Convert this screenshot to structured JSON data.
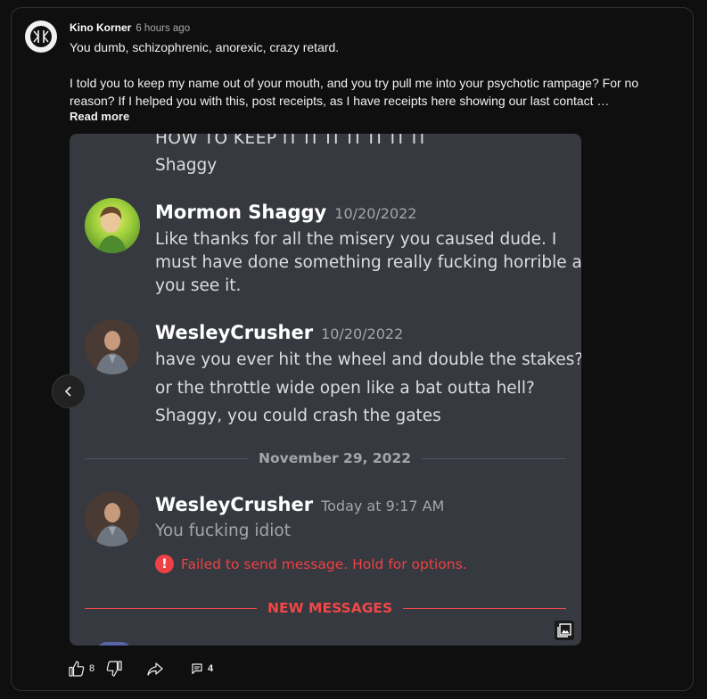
{
  "comment": {
    "author": "Kino Korner",
    "time": "6 hours ago",
    "text_line1": "You dumb, schizophrenic, anorexic, crazy retard.",
    "text_para2": "I told you to keep my name out of your mouth, and you try pull me into your psychotic rampage? For no reason? If I helped you with this, post receipts, as I have receipts here showing our last contact …",
    "read_more": "Read more",
    "likes": "8",
    "replies": "4"
  },
  "image": {
    "top_cut_line": "HOW TO KEEP IT IT IT IT IT IT IT",
    "top_sign": "Shaggy",
    "msg1": {
      "name": "Mormon Shaggy",
      "date": "10/20/2022",
      "lines": [
        "Like thanks for all the misery you caused dude.  I",
        "must have done something really fucking horrible as",
        "you see it."
      ]
    },
    "msg2": {
      "name": "WesleyCrusher",
      "date": "10/20/2022",
      "lines": [
        "have you ever hit the wheel and double the stakes?",
        "or the throttle wide open like a bat outta hell?",
        "Shaggy, you could crash the gates"
      ]
    },
    "date_divider": "November 29, 2022",
    "msg3": {
      "name": "WesleyCrusher",
      "date": "Today at 9:17 AM",
      "text": "You fucking idiot",
      "error": "Failed to send message. Hold for options."
    },
    "new_messages": "NEW MESSAGES"
  },
  "icons": {
    "like": "thumbs-up-icon",
    "dislike": "thumbs-down-icon",
    "share": "share-icon",
    "reply": "comment-icon",
    "prev": "chevron-left-icon",
    "gallery": "gallery-icon"
  },
  "colors": {
    "background": "#0f0f0f",
    "discord_bg": "#36393f",
    "error_red": "#ed4245",
    "new_messages_red": "#f04747"
  }
}
